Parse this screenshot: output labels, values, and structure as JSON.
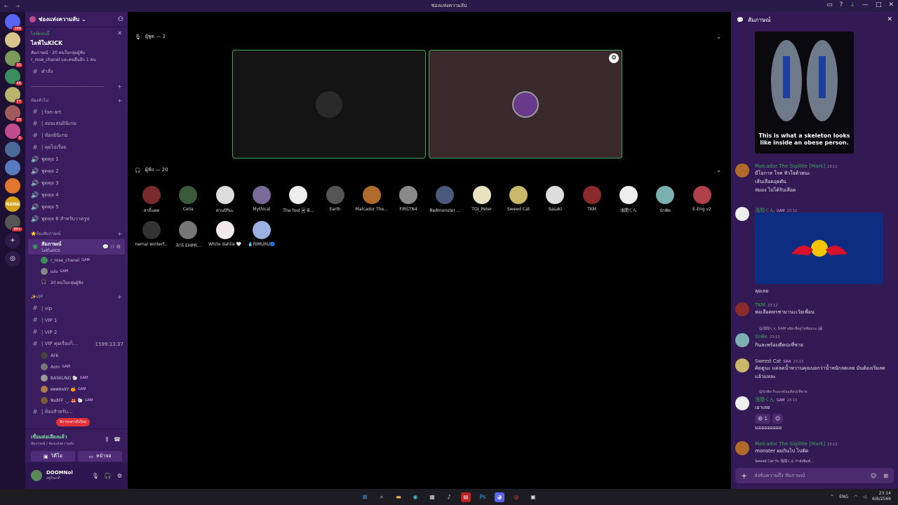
{
  "window": {
    "title": "ช่องแห่งความลับ"
  },
  "guilds": [
    {
      "badge": "184",
      "color": "#5865f2",
      "icon": "discord-icon"
    },
    {
      "badge": "",
      "color": "#d9c48a"
    },
    {
      "badge": "30",
      "color": "#7a9a5c"
    },
    {
      "badge": "48",
      "color": "#3b8d5e"
    },
    {
      "badge": "77",
      "color": "#b9b56c"
    },
    {
      "badge": "20",
      "color": "#a05c5c"
    },
    {
      "badge": "5",
      "color": "#c24b8e"
    },
    {
      "badge": "",
      "color": "#4a6a9a"
    },
    {
      "badge": "",
      "color": "#5a7ac0"
    },
    {
      "badge": "",
      "color": "#e0772d"
    },
    {
      "badge": "",
      "color": "#d6a21c",
      "label": "NANA"
    },
    {
      "badge": "99+",
      "color": "#555"
    }
  ],
  "server": {
    "name": "ช่องแห่งความลับ",
    "event": {
      "live": "ไลฟ์ตอนนี้",
      "name": "ไลฟ์ในKICK",
      "meta": "สัมภาษณ์ · 20 คนในกลุ่มผู้ฟัง",
      "meta2": "r_rose_chanel และคนอื่นอีก 1 คน"
    },
    "channels_top": [
      {
        "label": "คำสั่ง"
      }
    ],
    "divider": "------------------------------------------------",
    "cat1": "ห้องทั่วไป",
    "text_channels": [
      {
        "label": "| fan-art"
      },
      {
        "label": "| สอนเล่นมินิเกม"
      },
      {
        "label": "| ห้องมินิเกม"
      },
      {
        "label": "| คุยไปเรื่อย"
      }
    ],
    "voice_channels": [
      {
        "label": "พูดคุย 1"
      },
      {
        "label": "พูดคุย 2"
      },
      {
        "label": "พูดคุย 3"
      },
      {
        "label": "พูดคุย 4"
      },
      {
        "label": "พูดคุย 5"
      },
      {
        "label": "พูดคุย 6 สำหรับวาดรูป"
      }
    ],
    "cat2": "⭐ห้องสัมภาษณ์",
    "stage": {
      "label": "สัมภาษณ์",
      "sub": "ไลฟ์ในKICK"
    },
    "stage_users": [
      {
        "name": "r_rose_chanel",
        "tag": "GAM",
        "color": "#3b8d5e"
      },
      {
        "name": "แสง",
        "tag": "GAM",
        "color": "#888"
      },
      {
        "name": "20 คนในกลุ่มผู้ฟัง",
        "tag": "",
        "color": ""
      }
    ],
    "cat3": "✨VIP",
    "vip_channels": [
      {
        "label": "| vip"
      },
      {
        "label": "| VIP 1"
      },
      {
        "label": "| VIP 2"
      },
      {
        "label": "| VIP คุยเรื่องก็...",
        "right": "1599:13:37"
      }
    ],
    "vip_users": [
      {
        "name": "AFK",
        "tag": "",
        "color": "#444"
      },
      {
        "name": "Aom",
        "tag": "GAM",
        "color": "#777"
      },
      {
        "name": "BASKUNG 🐑",
        "tag": "GAM",
        "color": "#999"
      },
      {
        "name": "ศศศศหKY 🍊",
        "tag": "GAM",
        "color": "#b07a4a"
      },
      {
        "name": "ฟิลลิFF ._. 🦊 🐑",
        "tag": "GAM",
        "color": "#7a5a3a"
      }
    ],
    "last_channel": "| ห้องสำหรับ...",
    "new_messages": "มีการกล่าวถึงใหม่"
  },
  "voicebar": {
    "status": "เชื่อมต่อเสียงแล้ว",
    "sub": "สัมภาษณ์ / ช่องแห่งความลับ",
    "video": "วิดีโอ",
    "screen": "หน้าจอ"
  },
  "user": {
    "name": "DOOMNol",
    "status": "อยู่ในเวที"
  },
  "stage_view": {
    "speakers_header": "ผู้พูด — 2",
    "audience_header": "ผู้ฟัง — 20",
    "audience": [
      {
        "name": "สาธิ์แดท",
        "color": "#7a2a2a"
      },
      {
        "name": "Celia",
        "color": "#3a5a3a"
      },
      {
        "name": "ท่านปิริมะ",
        "color": "#ddd"
      },
      {
        "name": "Mythical",
        "color": "#7a6a9a"
      },
      {
        "name": "The fool 🃏 พี...",
        "color": "#eee"
      },
      {
        "name": "Earth",
        "color": "#555"
      },
      {
        "name": "Malcador The...",
        "color": "#b06a2a"
      },
      {
        "name": "FIRSTN4",
        "color": "#8a8a8a"
      },
      {
        "name": "คิดส์monster ...",
        "color": "#4a5a7a"
      },
      {
        "name": "TOI_Peter",
        "color": "#e8e2c0"
      },
      {
        "name": "Sweed Cat",
        "color": "#c9b86a"
      },
      {
        "name": "Sasaki",
        "color": "#ddd"
      },
      {
        "name": "TKM",
        "color": "#8a2a2a"
      },
      {
        "name": "浅間くん",
        "color": "#eee"
      },
      {
        "name": "บักพิท",
        "color": "#7ab0b0"
      },
      {
        "name": "E-Eng v2",
        "color": "#b0404a"
      },
      {
        "name": "nemai winterf...",
        "color": "#333"
      },
      {
        "name": "卍卐 EMPR...",
        "color": "#777"
      },
      {
        "name": "White dahlia 🤍",
        "color": "#f2e8ee"
      },
      {
        "name": "💧RIMURU🔵",
        "color": "#9ab0e0"
      }
    ]
  },
  "chat": {
    "title": "สัมภาษณ์",
    "image_caption": "This is what a skeleton looks like inside an obese person.",
    "messages": [
      {
        "author": "Malcador The Sigillite [Mark]",
        "time": "23:11",
        "lines": [
          "มีโอกาส โรค หัวใจด้วยนะ",
          "เส้นเลือดอุดตัน",
          "สมอง ไม่ได้รับเลือด"
        ],
        "color": "#3ba55d",
        "av": "#b06a2a"
      },
      {
        "author": "浅間くん",
        "tag": "GAM",
        "time": "23:12",
        "lines": [
          "ลุยเลย"
        ],
        "color": "#3ba55d",
        "av": "#eee"
      },
      {
        "author": "TKM",
        "time": "23:12",
        "lines": [
          "ห่อเลือดหรชามานะเว้ยเพื่อน"
        ],
        "color": "#3ba55d",
        "av": "#8a2a2a"
      },
      {
        "reply": "@浅間くん GAM ลมิดเพื่อดูไฟฟ์ผมนะ 🖼",
        "author": "บักพิท",
        "time": "23:13",
        "lines": [
          "กินละพร้อมดีดปะที่ชาย"
        ],
        "color": "#3ba55d",
        "av": "#7ab0b0"
      },
      {
        "author": "Sweed Cat",
        "tag": "SIRA",
        "time": "23:13",
        "lines": [
          "คิดดูนะ แค่ลดน้ำหวานคุณบอกว่าน้ำหนักลดเลย มันต้องเริ่มลดแล้วแหละ"
        ],
        "color": "#ccc",
        "av": "#c9b86a"
      },
      {
        "reply": "@บักพิท กินละพร้อมดีดปะที่ชาย",
        "author": "浅間くん",
        "tag": "GAM",
        "time": "23:13",
        "lines": [
          "เอาเลย"
        ],
        "reactions": [
          "😆 1",
          "☺"
        ],
        "extra": "มออออออออ",
        "color": "#3ba55d",
        "av": "#eee"
      },
      {
        "author": "Malcador The Sigillite [Mark]",
        "time": "23:13",
        "lines": [
          "monster ผมกินไป ไปตัด"
        ],
        "color": "#3ba55d",
        "av": "#b06a2a"
      }
    ],
    "typing": "Sweed Cat กับ 浅間くん กำลังพิมพ์...",
    "input_placeholder": "ส่งข้อความถึง สัมภาษณ์"
  },
  "taskbar": {
    "lang": "ENG",
    "time": "23:14",
    "date": "6/8/2569"
  }
}
